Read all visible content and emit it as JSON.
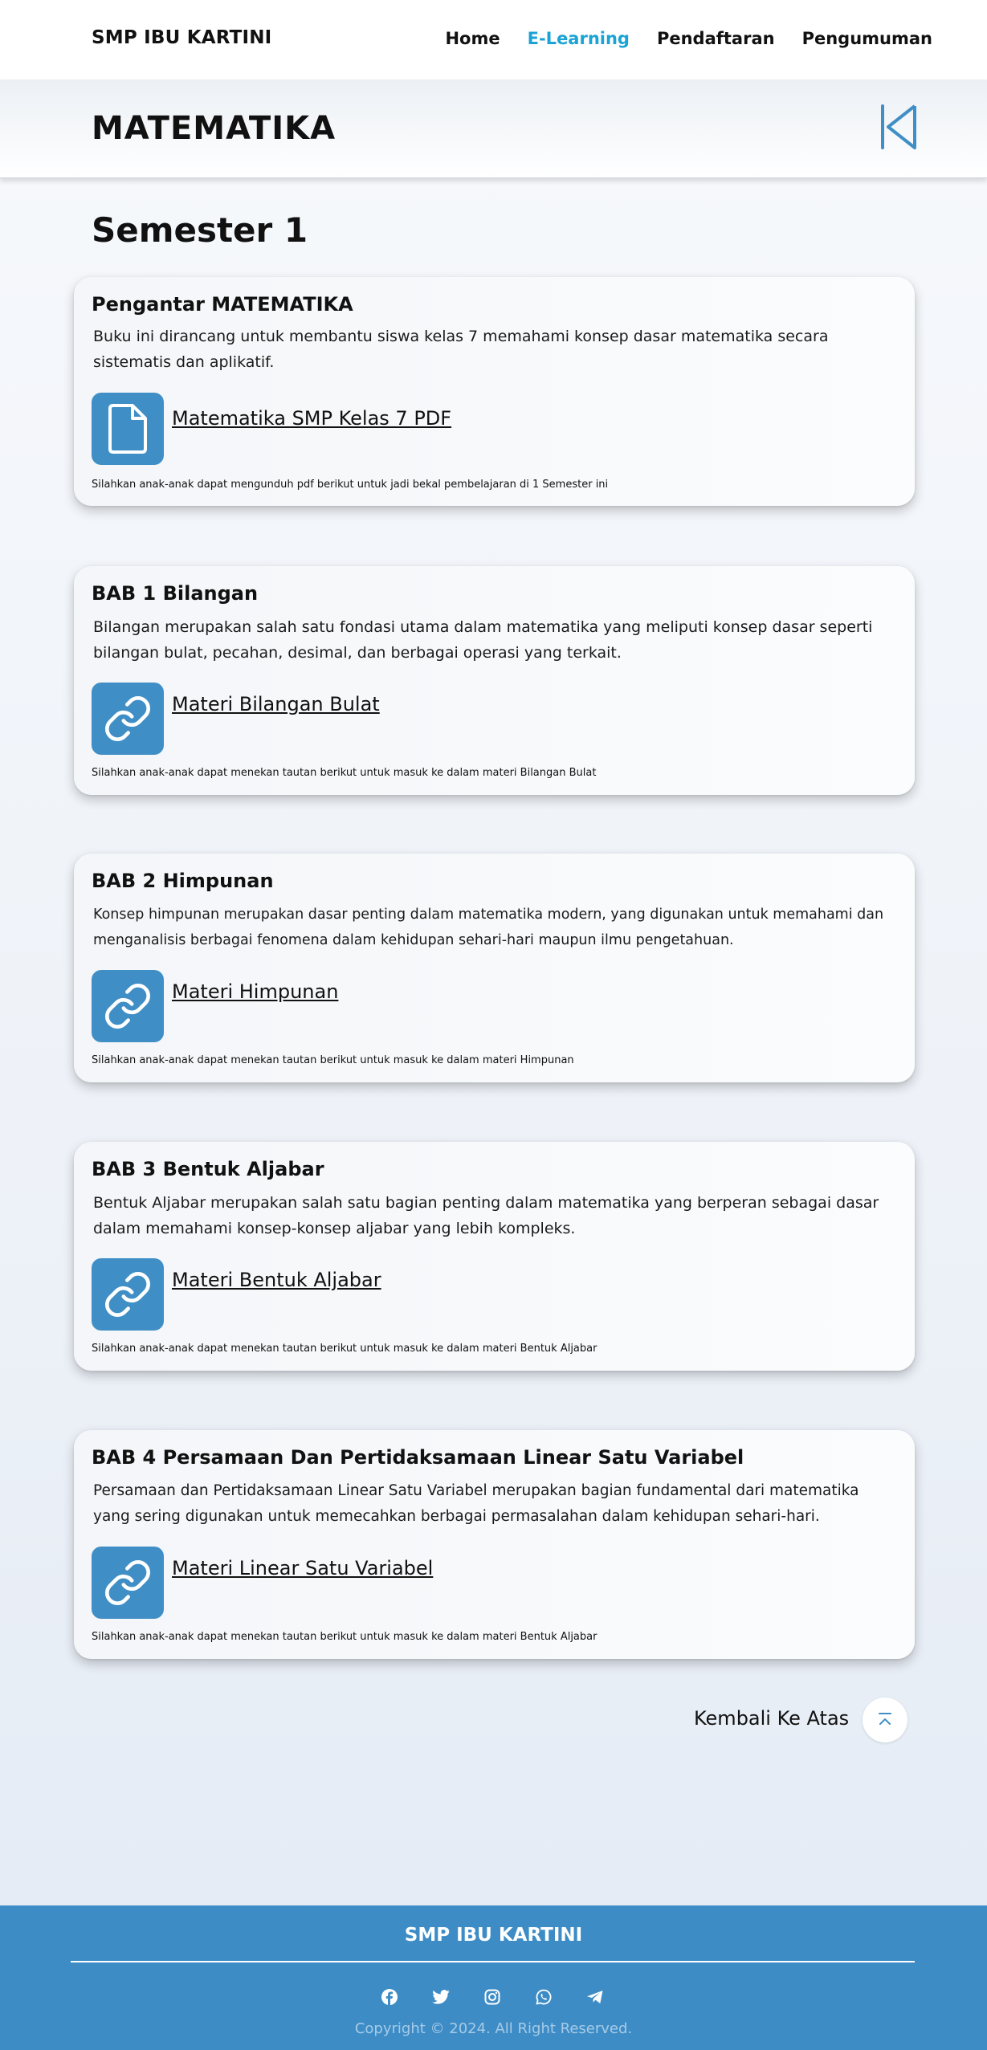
{
  "navbar": {
    "brand": "SMP IBU KARTINI",
    "links": [
      "Home",
      "E-Learning",
      "Pendaftaran",
      "Pengumuman"
    ],
    "active_link": "E-Learning"
  },
  "subject": {
    "title": "MATEMATIKA",
    "back_icon": "skip-back-icon"
  },
  "semester": {
    "title": "Semester 1"
  },
  "cards": [
    {
      "title": "Pengantar MATEMATIKA",
      "description": "Buku ini dirancang untuk membantu siswa kelas 7 memahami konsep dasar matematika secara sistematis dan aplikatif.",
      "icon": "file-icon",
      "link": "Matematika SMP Kelas 7 PDF",
      "note": "Silahkan anak-anak dapat mengunduh pdf berikut untuk jadi bekal pembelajaran di 1 Semester ini"
    },
    {
      "title": "BAB 1 Bilangan",
      "description": "Bilangan merupakan salah satu fondasi utama dalam matematika yang meliputi konsep dasar seperti bilangan bulat, pecahan, desimal, dan berbagai operasi yang terkait.",
      "icon": "link-icon",
      "link": "Materi Bilangan Bulat",
      "note": "Silahkan anak-anak dapat menekan tautan berikut untuk masuk ke dalam materi Bilangan Bulat"
    },
    {
      "title": "BAB 2 Himpunan",
      "description": "Konsep himpunan merupakan dasar penting dalam matematika modern, yang digunakan untuk memahami dan menganalisis berbagai fenomena dalam kehidupan sehari-hari maupun ilmu pengetahuan.",
      "icon": "link-icon",
      "link": "Materi Himpunan",
      "note": "Silahkan anak-anak dapat menekan tautan berikut untuk masuk ke dalam materi Himpunan"
    },
    {
      "title": "BAB 3 Bentuk Aljabar",
      "description": "Bentuk Aljabar merupakan salah satu bagian penting dalam matematika yang berperan sebagai dasar dalam memahami konsep-konsep aljabar yang lebih kompleks.",
      "icon": "link-icon",
      "link": "Materi Bentuk Aljabar",
      "note": "Silahkan anak-anak dapat menekan tautan berikut untuk masuk ke dalam materi Bentuk Aljabar"
    },
    {
      "title": "BAB 4 Persamaan Dan Pertidaksamaan Linear Satu Variabel",
      "description": "Persamaan dan Pertidaksamaan Linear Satu Variabel merupakan bagian fundamental dari matematika yang sering digunakan untuk memecahkan berbagai permasalahan dalam kehidupan sehari-hari.",
      "icon": "link-icon",
      "link": "Materi Linear Satu Variabel",
      "note": "Silahkan anak-anak dapat menekan tautan berikut untuk masuk ke dalam materi Bentuk Aljabar"
    }
  ],
  "back_to_top": {
    "label": "Kembali Ke Atas",
    "icon": "arrow-up-to-line-icon"
  },
  "footer": {
    "title": "SMP IBU KARTINI",
    "social_icons": [
      "facebook-icon",
      "twitter-icon",
      "instagram-icon",
      "whatsapp-icon",
      "telegram-icon"
    ],
    "copyright": "Copyright © 2024. All Right Reserved."
  },
  "colors": {
    "accent": "#1aa3d4",
    "icon_tile": "#3f8fc6",
    "footer": "#3d8cc6"
  }
}
